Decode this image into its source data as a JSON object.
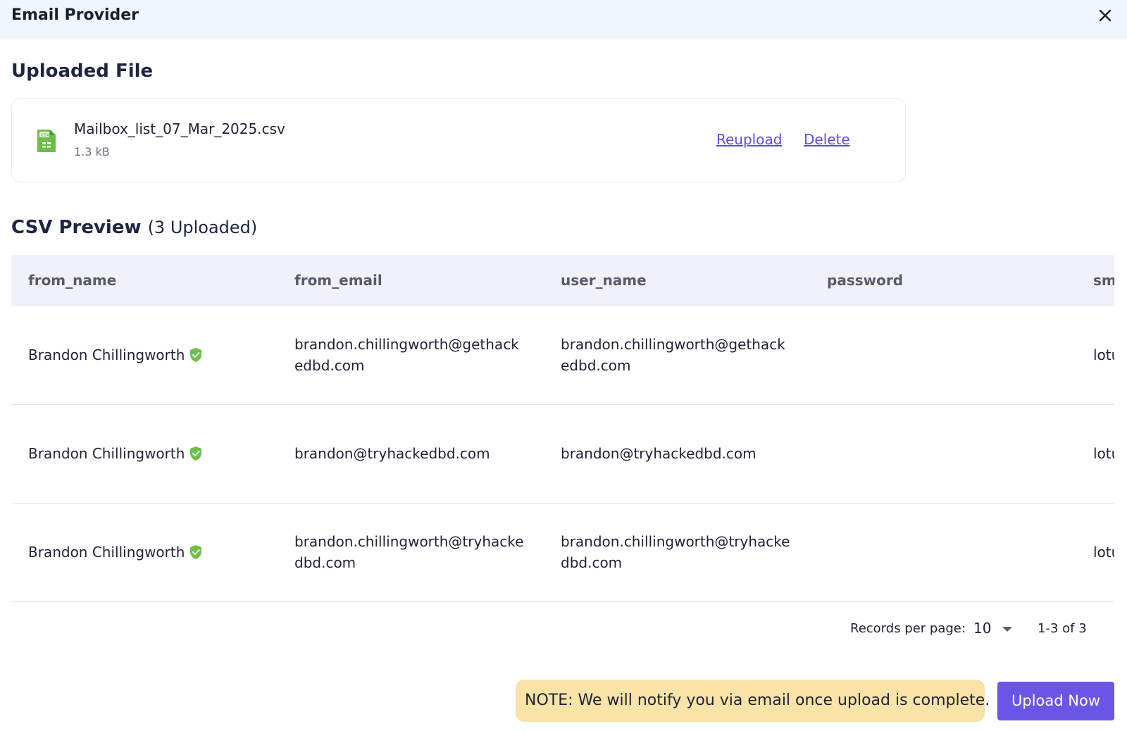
{
  "header": {
    "title": "Email Provider",
    "close_icon": "close-icon"
  },
  "uploaded_section": {
    "title": "Uploaded File"
  },
  "file": {
    "icon": "csv-file-icon",
    "name": "Mailbox_list_07_Mar_2025.csv",
    "size": "1.3 kB",
    "reupload_label": "Reupload",
    "delete_label": "Delete"
  },
  "preview": {
    "title": "CSV Preview",
    "count": "(3 Uploaded)"
  },
  "table": {
    "columns": [
      "from_name",
      "from_email",
      "user_name",
      "password",
      "sm"
    ],
    "rows": [
      {
        "from_name": "Brandon Chillingworth",
        "from_email": "brandon.chillingworth@gethackedbd.com",
        "user_name": "brandon.chillingworth@gethackedbd.com",
        "password": "",
        "smtp": "lotu"
      },
      {
        "from_name": "Brandon Chillingworth",
        "from_email": "brandon@tryhackedbd.com",
        "user_name": "brandon@tryhackedbd.com",
        "password": "",
        "smtp": "lotu"
      },
      {
        "from_name": "Brandon Chillingworth",
        "from_email": "brandon.chillingworth@tryhackedbd.com",
        "user_name": "brandon.chillingworth@tryhackedbd.com",
        "password": "",
        "smtp": "lotu"
      }
    ]
  },
  "pagination": {
    "records_label": "Records per page:",
    "per_page": "10",
    "range": "1-3 of 3"
  },
  "note": "NOTE: We will notify you via email once upload is complete.",
  "upload_button": "Upload Now",
  "colors": {
    "accent": "#6a55e6",
    "link": "#5b4ce6",
    "verified": "#6cc04a",
    "note_bg": "#f9e3a6",
    "header_bg": "#f1f5fd"
  }
}
